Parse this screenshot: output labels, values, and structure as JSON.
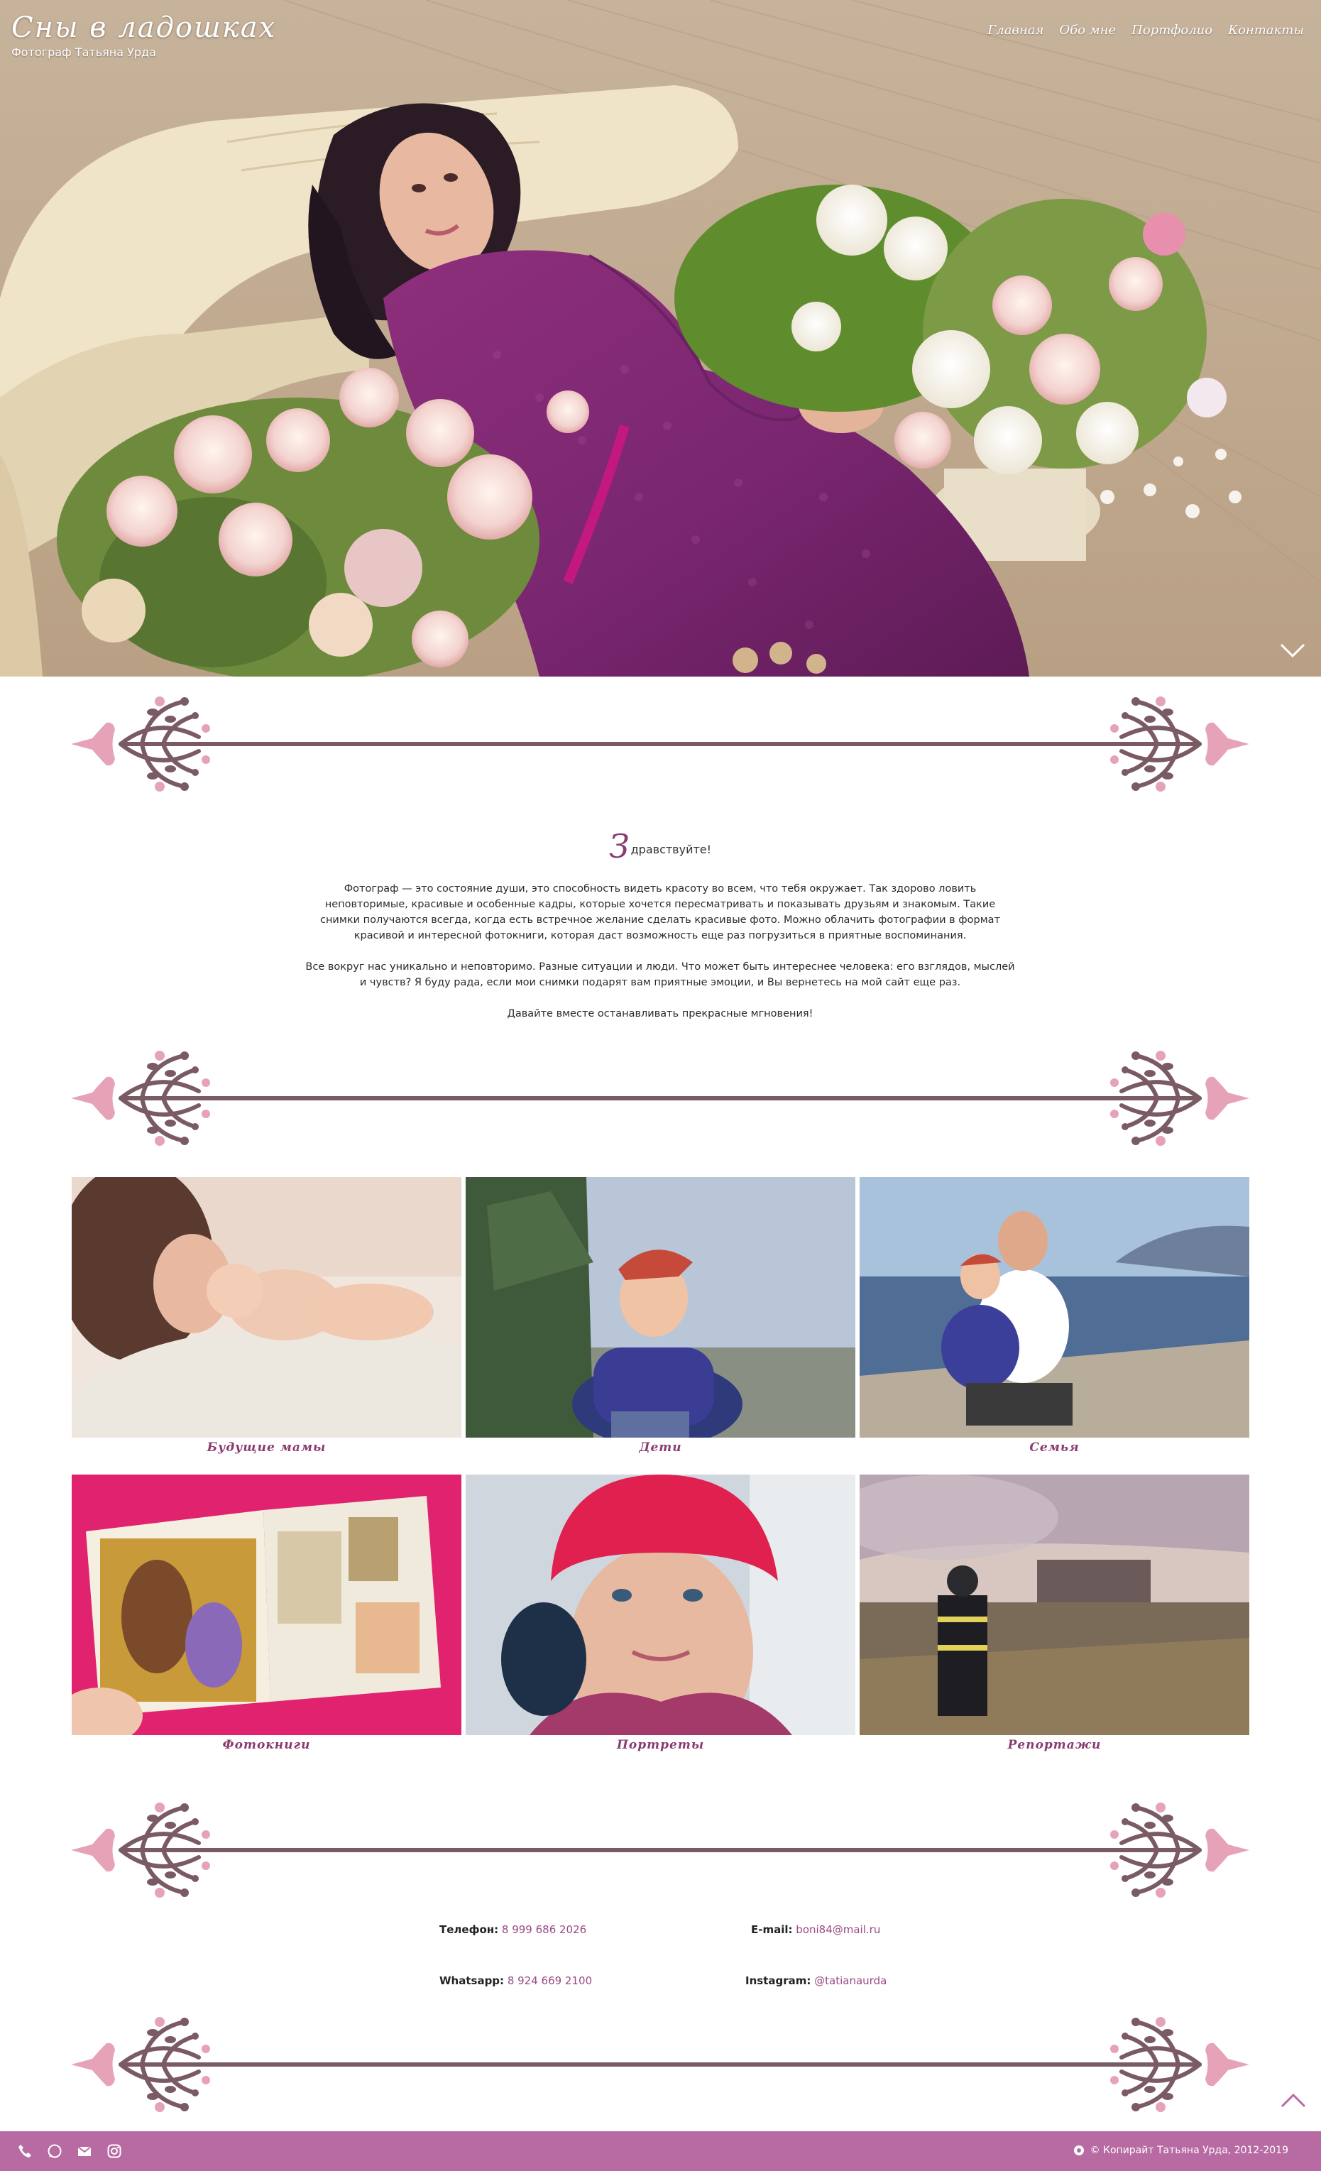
{
  "site": {
    "title": "Сны в ладошках",
    "subtitle": "Фотограф Татьяна Урда"
  },
  "nav": [
    {
      "label": "Главная"
    },
    {
      "label": "Обо мне"
    },
    {
      "label": "Портфолио"
    },
    {
      "label": "Контакты"
    }
  ],
  "greeting": {
    "capital": "З",
    "rest": "дравствуйте!",
    "p1": "Фотограф — это состояние души, это способность видеть красоту во всем, что тебя окружает. Так здорово ловить неповторимые, красивые и особенные кадры, которые хочется пересматривать и показывать друзьям и знакомым. Такие снимки получаются всегда, когда есть встречное желание сделать красивые фото. Можно облачить фотографии в формат красивой и интересной фотокниги, которая даст возможность еще раз погрузиться в приятные воспоминания.",
    "p2": "Все вокруг нас уникально и неповторимо. Разные ситуации и люди. Что может быть интереснее человека: его взглядов, мыслей и чувств? Я буду рада, если мои снимки подарят вам приятные эмоции, и Вы вернетесь на мой сайт еще раз.",
    "p3": "Давайте вместе останавливать прекрасные мгновения!"
  },
  "gallery": [
    {
      "caption": "Будущие мамы"
    },
    {
      "caption": "Дети"
    },
    {
      "caption": "Семья"
    },
    {
      "caption": "Фотокниги"
    },
    {
      "caption": "Портреты"
    },
    {
      "caption": "Репортажи"
    }
  ],
  "contacts": {
    "phone_label": "Телефон:",
    "phone": "8 999 686 2026",
    "email_label": "E-mail:",
    "email": "boni84@mail.ru",
    "whatsapp_label": "Whatsapp:",
    "whatsapp": "8 924 669 2100",
    "instagram_label": "Instagram:",
    "instagram": "@tatianaurda"
  },
  "footer": {
    "icons": [
      "phone-icon",
      "whatsapp-icon",
      "mail-icon",
      "instagram-icon"
    ],
    "copyright": "© Копирайт Татьяна Урда, 2012-2019"
  },
  "colors": {
    "accent": "#8a3b70",
    "link": "#9a4b86",
    "footer": "#b86aa3",
    "ornament_pink": "#e6a3b8",
    "ornament_brown": "#7a5a63"
  }
}
